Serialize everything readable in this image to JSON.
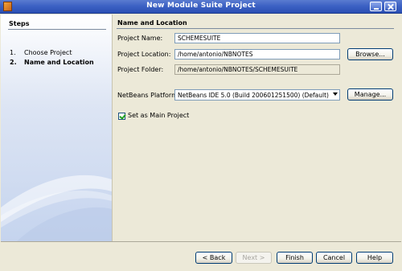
{
  "window": {
    "title": "New Module Suite Project"
  },
  "steps": {
    "header": "Steps",
    "items": [
      {
        "number": "1.",
        "label": "Choose Project"
      },
      {
        "number": "2.",
        "label": "Name and Location"
      }
    ]
  },
  "panel": {
    "title": "Name and Location",
    "project_name_label": "Project Name:",
    "project_name_value": "SCHEMESUITE",
    "project_location_label": "Project Location:",
    "project_location_value": "/home/antonio/NBNOTES",
    "browse_label": "Browse...",
    "project_folder_label": "Project Folder:",
    "project_folder_value": "/home/antonio/NBNOTES/SCHEMESUITE",
    "platform_label": "NetBeans Platform:",
    "platform_value": "NetBeans IDE 5.0 (Build 200601251500) (Default)",
    "manage_label": "Manage...",
    "main_project_label": "Set as Main Project",
    "main_project_checked": true
  },
  "buttons": {
    "back": "< Back",
    "next": "Next >",
    "finish": "Finish",
    "cancel": "Cancel",
    "help": "Help"
  }
}
